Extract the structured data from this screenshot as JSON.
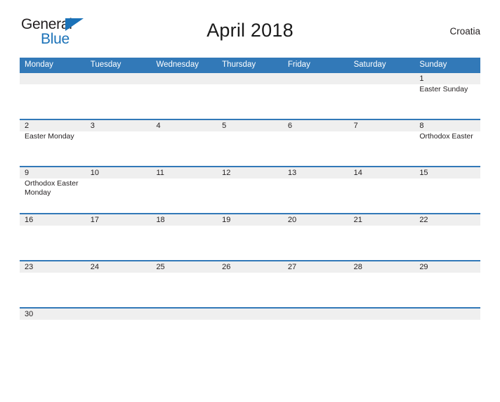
{
  "brand": {
    "name_part1": "General",
    "name_part2": "Blue",
    "flag_color": "#1b72b8"
  },
  "header": {
    "title": "April 2018",
    "country": "Croatia",
    "accent_color": "#3279b8"
  },
  "calendar": {
    "weekdays": [
      "Monday",
      "Tuesday",
      "Wednesday",
      "Thursday",
      "Friday",
      "Saturday",
      "Sunday"
    ],
    "weeks": [
      {
        "days": [
          {
            "num": "",
            "events": []
          },
          {
            "num": "",
            "events": []
          },
          {
            "num": "",
            "events": []
          },
          {
            "num": "",
            "events": []
          },
          {
            "num": "",
            "events": []
          },
          {
            "num": "",
            "events": []
          },
          {
            "num": "1",
            "events": [
              "Easter Sunday"
            ]
          }
        ]
      },
      {
        "days": [
          {
            "num": "2",
            "events": [
              "Easter Monday"
            ]
          },
          {
            "num": "3",
            "events": []
          },
          {
            "num": "4",
            "events": []
          },
          {
            "num": "5",
            "events": []
          },
          {
            "num": "6",
            "events": []
          },
          {
            "num": "7",
            "events": []
          },
          {
            "num": "8",
            "events": [
              "Orthodox Easter"
            ]
          }
        ]
      },
      {
        "days": [
          {
            "num": "9",
            "events": [
              "Orthodox Easter Monday"
            ]
          },
          {
            "num": "10",
            "events": []
          },
          {
            "num": "11",
            "events": []
          },
          {
            "num": "12",
            "events": []
          },
          {
            "num": "13",
            "events": []
          },
          {
            "num": "14",
            "events": []
          },
          {
            "num": "15",
            "events": []
          }
        ]
      },
      {
        "days": [
          {
            "num": "16",
            "events": []
          },
          {
            "num": "17",
            "events": []
          },
          {
            "num": "18",
            "events": []
          },
          {
            "num": "19",
            "events": []
          },
          {
            "num": "20",
            "events": []
          },
          {
            "num": "21",
            "events": []
          },
          {
            "num": "22",
            "events": []
          }
        ]
      },
      {
        "days": [
          {
            "num": "23",
            "events": []
          },
          {
            "num": "24",
            "events": []
          },
          {
            "num": "25",
            "events": []
          },
          {
            "num": "26",
            "events": []
          },
          {
            "num": "27",
            "events": []
          },
          {
            "num": "28",
            "events": []
          },
          {
            "num": "29",
            "events": []
          }
        ]
      },
      {
        "short": true,
        "days": [
          {
            "num": "30",
            "events": []
          },
          {
            "num": "",
            "events": []
          },
          {
            "num": "",
            "events": []
          },
          {
            "num": "",
            "events": []
          },
          {
            "num": "",
            "events": []
          },
          {
            "num": "",
            "events": []
          },
          {
            "num": "",
            "events": []
          }
        ]
      }
    ]
  }
}
